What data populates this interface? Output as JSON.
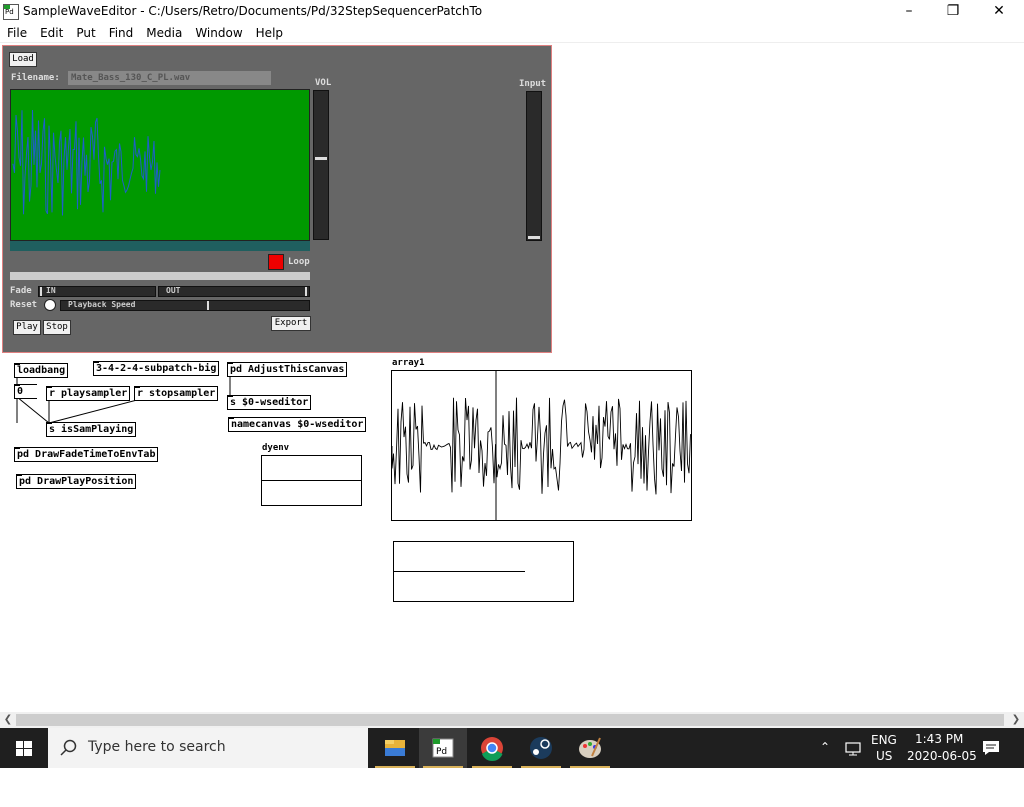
{
  "window": {
    "title": "SampleWaveEditor  - C:/Users/Retro/Documents/Pd/32StepSequencerPatchTo",
    "controls": [
      "minimize",
      "maximize",
      "close"
    ]
  },
  "menubar": [
    "File",
    "Edit",
    "Put",
    "Find",
    "Media",
    "Window",
    "Help"
  ],
  "gui": {
    "load_label": "Load",
    "filename_label": "Filename:",
    "filename_value": "Mate_Bass_130_C_PL.wav",
    "vol_label": "VOL",
    "input_label": "Input",
    "loop_label": "Loop",
    "fade_label": "Fade",
    "fade_in_label": "IN",
    "fade_out_label": "OUT",
    "reset_label": "Reset",
    "playback_speed_label": "Playback Speed",
    "play_label": "Play",
    "stop_label": "Stop",
    "export_label": "Export",
    "vol_level": 0.53,
    "input_level": 0.0,
    "playback_speed_level": 0.6,
    "loop_on": true,
    "colors": {
      "canvas": "#666666",
      "wave_bg": "#009900",
      "wave_line": "#1e5fc8",
      "loop": "#ee0000"
    }
  },
  "objects": {
    "loadbang": "loadbang",
    "subpatch": "3-4-2-4-subpatch-big",
    "adjust": "pd AdjustThisCanvas",
    "number": "0",
    "playsampler": "r playsampler",
    "stopsampler": "r stopsampler",
    "send_editor": "s $0-wseditor",
    "namecanvas": "namecanvas $0-wseditor",
    "issamplaying": "s isSamPlaying",
    "drawfade": "pd DrawFadeTimeToEnvTab",
    "drawplay": "pd DrawPlayPosition",
    "dyenv_label": "dyenv",
    "array_label": "array1"
  },
  "taskbar": {
    "search_placeholder": "Type here to search",
    "apps": [
      "file-explorer",
      "pure-data",
      "chrome",
      "steam",
      "paint"
    ],
    "lang_top": "ENG",
    "lang_bottom": "US",
    "time": "1:43 PM",
    "date": "2020-06-05"
  }
}
